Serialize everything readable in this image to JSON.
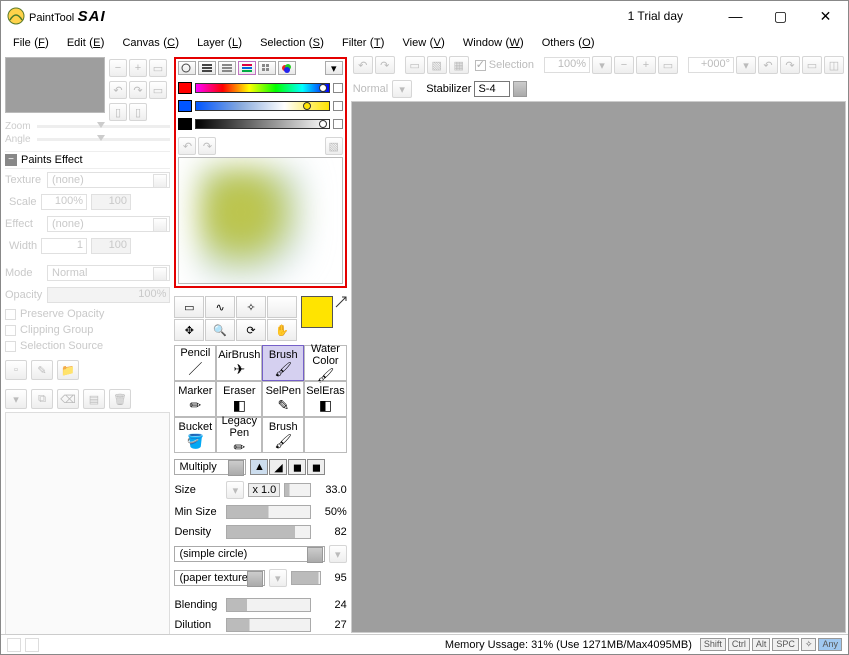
{
  "titlebar": {
    "app": "PaintTool",
    "sai": "SAI",
    "trial": "1 Trial day"
  },
  "menu": {
    "file": "File",
    "file_k": "F",
    "edit": "Edit",
    "edit_k": "E",
    "canvas": "Canvas",
    "canvas_k": "C",
    "layer": "Layer",
    "layer_k": "L",
    "selection": "Selection",
    "selection_k": "S",
    "filter": "Filter",
    "filter_k": "T",
    "view": "View",
    "view_k": "V",
    "window": "Window",
    "window_k": "W",
    "others": "Others",
    "others_k": "O"
  },
  "nav": {
    "zoom": "Zoom",
    "angle": "Angle"
  },
  "paints": {
    "header": "Paints Effect",
    "texture": "Texture",
    "texture_v": "(none)",
    "scale": "Scale",
    "scale_v": "100%",
    "scale_n": "100",
    "effect": "Effect",
    "effect_v": "(none)",
    "width": "Width",
    "width_v": "1",
    "width_n": "100",
    "mode": "Mode",
    "mode_v": "Normal",
    "opacity": "Opacity",
    "opacity_v": "100%",
    "preserve": "Preserve Opacity",
    "clipping": "Clipping Group",
    "selsrc": "Selection Source"
  },
  "toolbar_top": {
    "selection": "Selection",
    "zoom": "100%",
    "angle": "+000°",
    "normal": "Normal",
    "stabilizer": "Stabilizer",
    "stabilizer_v": "S-4"
  },
  "color": {
    "primary": "#ffe400"
  },
  "brushes": {
    "r1": [
      "Pencil",
      "AirBrush",
      "Brush",
      "Water Color"
    ],
    "r2": [
      "Marker",
      "Eraser",
      "SelPen",
      "SelEras"
    ],
    "r3": [
      "Bucket",
      "Legacy Pen",
      "Brush",
      ""
    ]
  },
  "params": {
    "blend": "Multiply",
    "size": "Size",
    "size_v": "33.0",
    "size_step": "x 1.0",
    "minsize": "Min Size",
    "minsize_v": "50%",
    "density": "Density",
    "density_v": "82",
    "shape": "(simple circle)",
    "tex": "(paper textures)",
    "tex_v": "95",
    "blending": "Blending",
    "blending_v": "24",
    "dilution": "Dilution",
    "dilution_v": "27"
  },
  "status": {
    "mem": "Memory Ussage: 31%  (Use 1271MB/Max4095MB)",
    "keys": [
      "Shift",
      "Ctrl",
      "Alt",
      "SPC",
      "✧",
      "Any"
    ]
  }
}
